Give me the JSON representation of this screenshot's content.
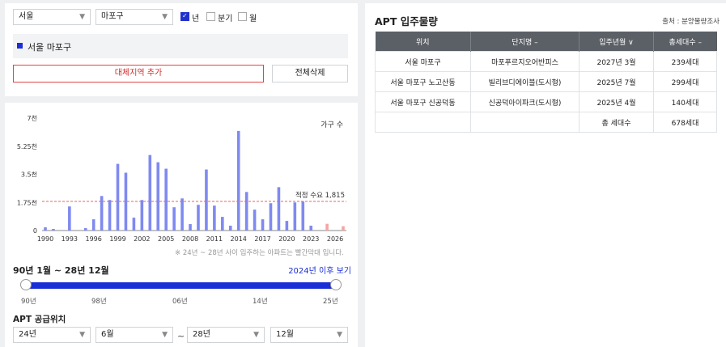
{
  "filters": {
    "region": "서울",
    "district": "마포구",
    "periods": [
      {
        "label": "년",
        "checked": true
      },
      {
        "label": "분기",
        "checked": false
      },
      {
        "label": "월",
        "checked": false
      }
    ]
  },
  "selected_region": "서울 마포구",
  "buttons": {
    "add_region": "대체지역 추가",
    "delete_all": "전체삭제"
  },
  "chart_data": {
    "type": "bar",
    "legend": "가구 수",
    "y_ticks": [
      "7천",
      "5.25천",
      "3.5천",
      "1.75천",
      "0"
    ],
    "ylim": [
      0,
      7000
    ],
    "x_tick_labels": [
      "1990",
      "1993",
      "1996",
      "1999",
      "2002",
      "2005",
      "2008",
      "2011",
      "2014",
      "2017",
      "2020",
      "2023",
      "2026"
    ],
    "x": [
      1990,
      1991,
      1992,
      1993,
      1994,
      1995,
      1996,
      1997,
      1998,
      1999,
      2000,
      2001,
      2002,
      2003,
      2004,
      2005,
      2006,
      2007,
      2008,
      2009,
      2010,
      2011,
      2012,
      2013,
      2014,
      2015,
      2016,
      2017,
      2018,
      2019,
      2020,
      2021,
      2022,
      2023,
      2024,
      2025,
      2026,
      2027
    ],
    "values": [
      200,
      100,
      0,
      1500,
      0,
      150,
      700,
      2150,
      1900,
      4150,
      3600,
      800,
      1900,
      4700,
      4250,
      3850,
      1450,
      2000,
      400,
      1600,
      3800,
      1550,
      850,
      300,
      6200,
      2400,
      1300,
      700,
      1700,
      2700,
      600,
      1750,
      1800,
      300,
      0,
      420,
      0,
      270
    ],
    "highlight_from": 2024,
    "bar_color": "#7f8af0",
    "highlight_color": "#f3a6a6",
    "reference": {
      "label": "적정 수요 1,815",
      "value": 1815,
      "color": "#e46666"
    }
  },
  "chart_note": "※ 24년 ~ 28년 사이 입주하는 아파트는 빨간막대 입니다.",
  "range": {
    "label": "90년 1월 ~ 28년 12월",
    "link": "2024년 이후 보기",
    "ticks": [
      "90년",
      "98년",
      "06년",
      "14년",
      "25년"
    ]
  },
  "supply": {
    "title": "APT 공급위치",
    "from_year": "24년",
    "from_month": "6월",
    "tilde": "~",
    "to_year": "28년",
    "to_month": "12월"
  },
  "right": {
    "title": "APT 입주물량",
    "source": "출처 : 분양물량조사",
    "columns": [
      "위치",
      "단지명 –",
      "입주년월 ∨",
      "총세대수 –"
    ],
    "rows": [
      [
        "서울 마포구",
        "마포푸르지오어반피스",
        "2027년 3월",
        "239세대"
      ],
      [
        "서울 마포구 노고산동",
        "빌리브디에이블(도시형)",
        "2025년 7월",
        "299세대"
      ],
      [
        "서울 마포구 신공덕동",
        "신공덕아이파크(도시형)",
        "2025년 4월",
        "140세대"
      ]
    ],
    "total_label": "총 세대수",
    "total_value": "678세대"
  }
}
